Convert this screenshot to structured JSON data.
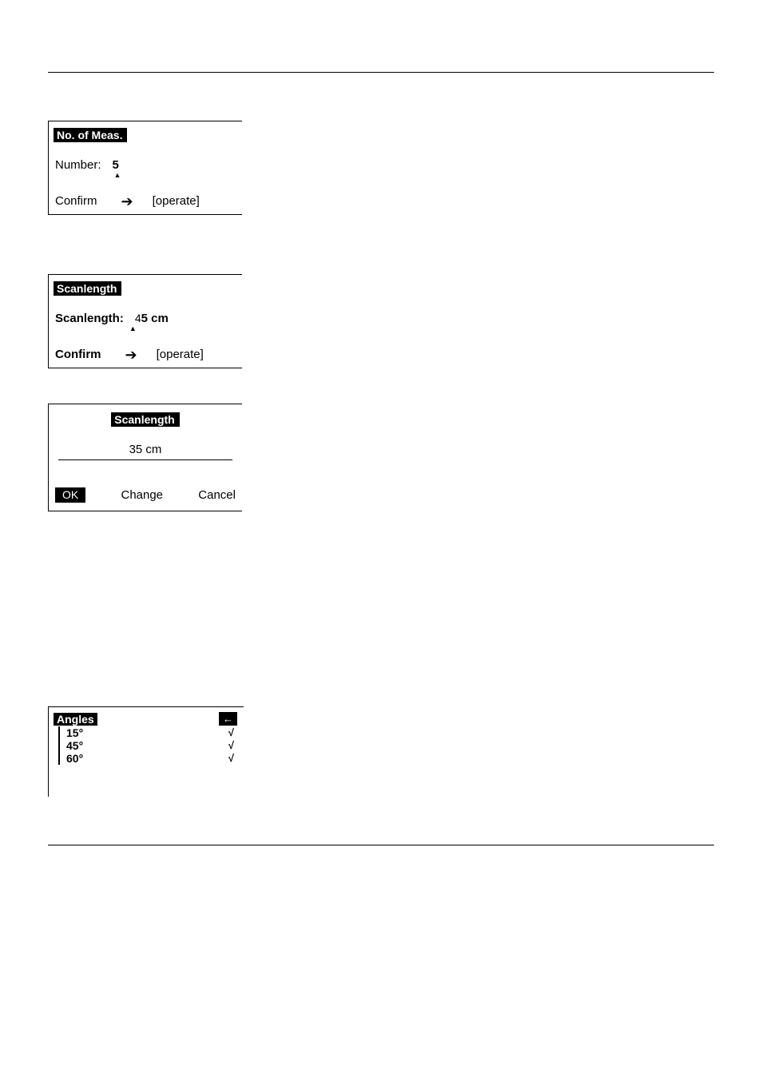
{
  "box1": {
    "title": "No. of Meas.",
    "label": "Number:",
    "value": "5",
    "confirm": "Confirm",
    "operate": "[operate]"
  },
  "box2": {
    "title": "Scanlength",
    "label": "Scanlength:",
    "digit_edit": "4",
    "value_rest": "5 cm",
    "confirm": "Confirm",
    "operate": "[operate]"
  },
  "box3": {
    "title": "Scanlength",
    "value": "35 cm",
    "ok": "OK",
    "change": "Change",
    "cancel": "Cancel"
  },
  "box4": {
    "title": "Angles",
    "rows": [
      {
        "label": "15°",
        "checked": "√"
      },
      {
        "label": "45°",
        "checked": "√"
      },
      {
        "label": "60°",
        "checked": "√"
      }
    ]
  }
}
